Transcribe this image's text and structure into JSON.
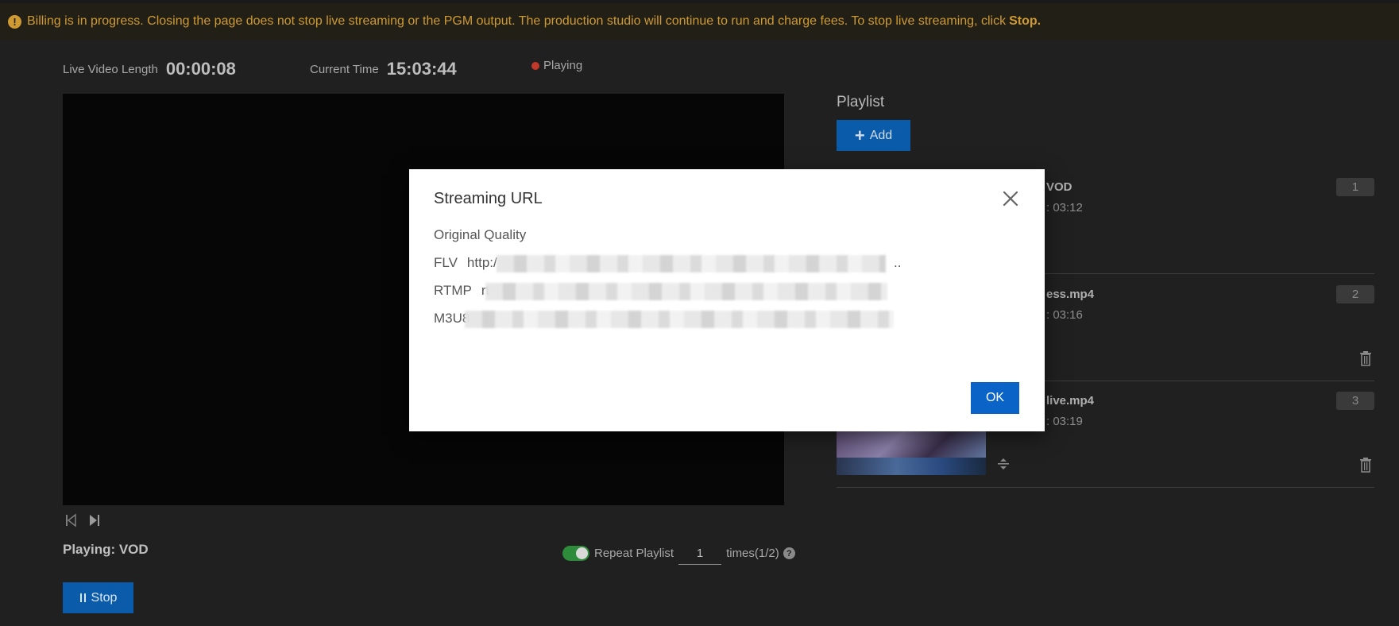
{
  "banner": {
    "icon": "exclamation-icon",
    "text": "Billing is in progress. Closing the page does not stop live streaming or the PGM output. The production studio will continue to run and charge fees. To stop live streaming, click",
    "stop_link": "Stop."
  },
  "status": {
    "video_length_label": "Live Video Length",
    "video_length_value": "00:00:08",
    "current_time_label": "Current Time",
    "current_time_value": "15:03:44",
    "state": "Playing"
  },
  "player": {
    "playing_label": "Playing: VOD",
    "repeat_label": "Repeat Playlist",
    "repeat_times": "1",
    "times_suffix": "times(1/2)",
    "help": "?",
    "stop_button": "Stop",
    "stop_icon": "pause-icon"
  },
  "playlist": {
    "title": "Playlist",
    "add_button": "Add",
    "items": [
      {
        "name": "VOD",
        "duration": ": 03:12",
        "number": "1"
      },
      {
        "name": "ess.mp4",
        "duration": ": 03:16",
        "number": "2"
      },
      {
        "name": "live.mp4",
        "duration": ": 03:19",
        "number": "3"
      }
    ]
  },
  "modal": {
    "title": "Streaming URL",
    "quality": "Original Quality",
    "rows": [
      {
        "label": "FLV",
        "value": "http:/"
      },
      {
        "label": "RTMP",
        "value": "rt"
      },
      {
        "label": "M3U8",
        "value": ""
      }
    ],
    "ok_button": "OK",
    "flv_tail": ".."
  },
  "colors": {
    "accent": "#0b5bab",
    "ok_button": "#0a64c8",
    "banner_text": "#cf9a32",
    "toggle_on": "#2e8b3b",
    "live_dot": "#c0392b"
  }
}
